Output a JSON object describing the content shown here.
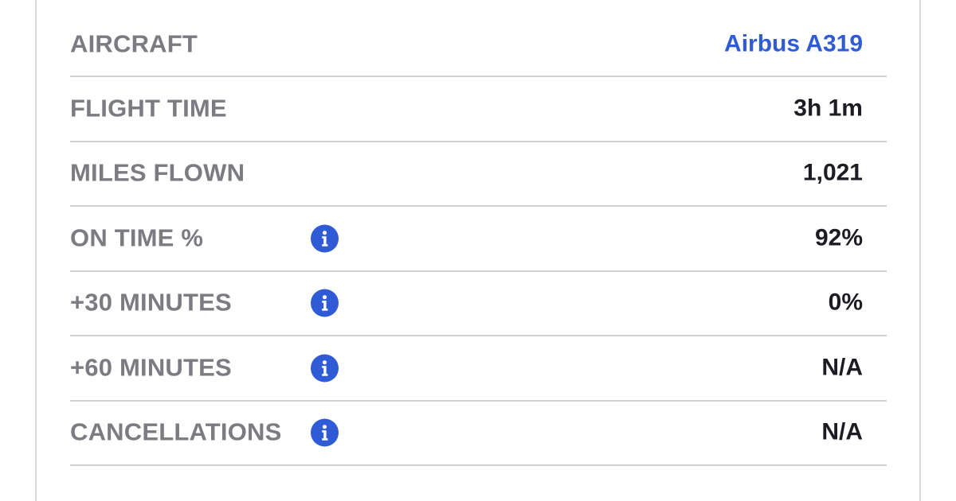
{
  "flight_stats": {
    "rows": [
      {
        "label": "AIRCRAFT",
        "value": "Airbus A319",
        "has_info": false,
        "value_is_link": true
      },
      {
        "label": "FLIGHT TIME",
        "value": "3h 1m",
        "has_info": false,
        "value_is_link": false
      },
      {
        "label": "MILES FLOWN",
        "value": "1,021",
        "has_info": false,
        "value_is_link": false
      },
      {
        "label": "ON TIME %",
        "value": "92%",
        "has_info": true,
        "value_is_link": false
      },
      {
        "label": "+30 MINUTES",
        "value": "0%",
        "has_info": true,
        "value_is_link": false
      },
      {
        "label": "+60 MINUTES",
        "value": "N/A",
        "has_info": true,
        "value_is_link": false
      },
      {
        "label": "CANCELLATIONS",
        "value": "N/A",
        "has_info": true,
        "value_is_link": false
      }
    ]
  },
  "icons": {
    "info": "info-icon"
  },
  "colors": {
    "label": "#7b7b82",
    "value": "#1c1c24",
    "link": "#2f5cd6",
    "info_bg": "#2f5cd6",
    "divider": "#d2d2d6"
  }
}
